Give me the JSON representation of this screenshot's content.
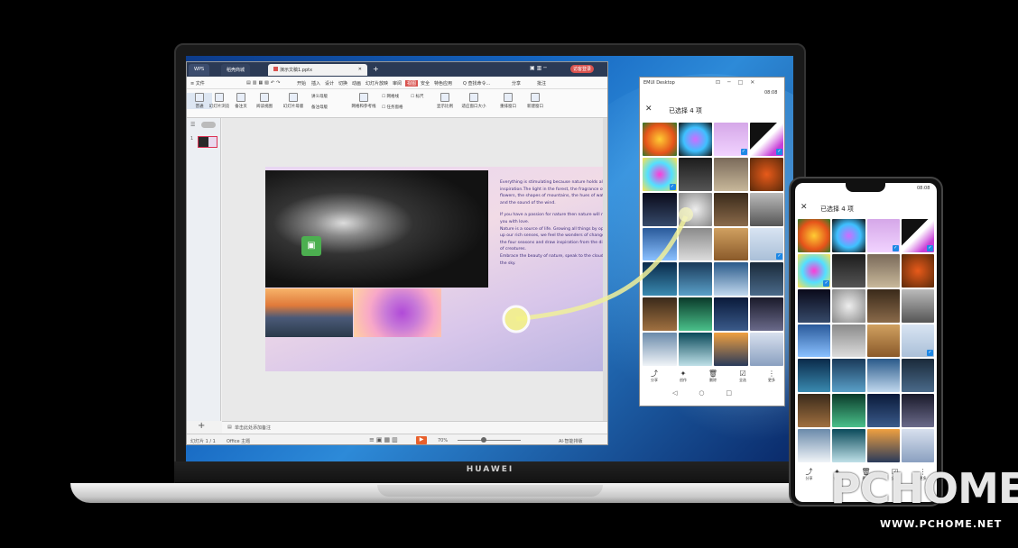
{
  "laptop": {
    "brand": "HUAWEI"
  },
  "wps": {
    "tabs": [
      {
        "label": "WPS"
      },
      {
        "label": "稻壳商城"
      },
      {
        "label": "演示文稿1.pptx"
      }
    ],
    "new_tab": "+",
    "login": "访客登录",
    "menu": [
      "≡ 文件",
      "开始",
      "插入",
      "设计",
      "切换",
      "动画",
      "幻灯片放映",
      "审阅",
      "视图",
      "安全",
      "特色应用",
      "Q 查找命令..."
    ],
    "menu_right": [
      "分享",
      "批注"
    ],
    "ribbon": [
      "普通",
      "幻灯片浏览",
      "备注页",
      "阅读视图",
      "幻灯片母版",
      "讲义母版",
      "备注母版",
      "网格和参考线",
      "网格线",
      "标尺",
      "任务窗格",
      "显示比例",
      "适应窗口大小",
      "重排窗口",
      "新建窗口"
    ],
    "slide_text": [
      "Everything is stimulating because nature holds all the inspiration.The light in the forest, the fragrance of flowers, the shapes of mountains, the hues of water, and the sound of the wind.",
      "If you have a passion for nature then nature will reward you with love.",
      "Nature is a source of life. Growing all things by opening up our rich senses, we feel the wonders of change from the four seasons and draw inspiration from the diversity of creatures.",
      "Embrace the beauty of nature, speak to the clouds in the sky."
    ],
    "notes": "单击此处添加备注",
    "status_left": "幻灯片 1 / 1",
    "status_theme": "Office 主题",
    "zoom": "70%",
    "ai": "AI·智能排版"
  },
  "emui": {
    "title": "EMUI Desktop",
    "time": "08:08",
    "selected": "已选择 4 项",
    "actions": [
      "分享",
      "创作",
      "删除",
      "全选",
      "更多"
    ]
  },
  "phone": {
    "time": "08:08",
    "selected": "已选择 4 项",
    "actions": [
      "分享",
      "创作",
      "删除",
      "全选",
      "更多"
    ]
  },
  "watermark": {
    "logo": "PCHOME",
    "url": "WWW.PCHOME.NET"
  },
  "colors": {
    "accent": "#1e88e5",
    "wps_tab": "#d9534f",
    "drag": "#f0f09a"
  }
}
